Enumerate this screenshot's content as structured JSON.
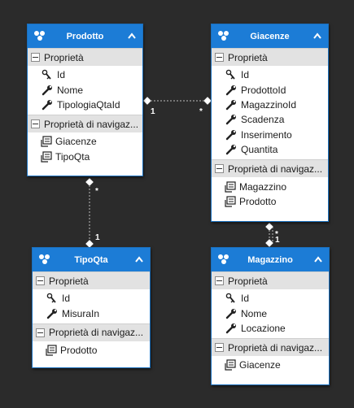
{
  "colors": {
    "background": "#2b2b2b",
    "entity_header": "#1c7cd6",
    "section_header": "#e2e2e2",
    "connector": "#bdbdbd"
  },
  "entities": {
    "prodotto": {
      "title": "Prodotto",
      "properties_label": "Proprietà",
      "properties": [
        "Id",
        "Nome",
        "TipologiaQtaId"
      ],
      "property_icons": [
        "key-wrench-icon",
        "wrench-icon",
        "wrench-icon"
      ],
      "nav_label": "Proprietà di navigaz...",
      "nav_properties": [
        "Giacenze",
        "TipoQta"
      ]
    },
    "giacenze": {
      "title": "Giacenze",
      "properties_label": "Proprietà",
      "properties": [
        "Id",
        "ProdottoId",
        "MagazzinoId",
        "Scadenza",
        "Inserimento",
        "Quantita"
      ],
      "property_icons": [
        "key-wrench-icon",
        "wrench-icon",
        "wrench-icon",
        "wrench-icon",
        "wrench-icon",
        "wrench-icon"
      ],
      "nav_label": "Proprietà di navigaz...",
      "nav_properties": [
        "Magazzino",
        "Prodotto"
      ]
    },
    "tipoqta": {
      "title": "TipoQta",
      "properties_label": "Proprietà",
      "properties": [
        "Id",
        "MisuraIn"
      ],
      "property_icons": [
        "key-wrench-icon",
        "wrench-icon"
      ],
      "nav_label": "Proprietà di navigaz...",
      "nav_properties": [
        "Prodotto"
      ]
    },
    "magazzino": {
      "title": "Magazzino",
      "properties_label": "Proprietà",
      "properties": [
        "Id",
        "Nome",
        "Locazione"
      ],
      "property_icons": [
        "key-wrench-icon",
        "wrench-icon",
        "wrench-icon"
      ],
      "nav_label": "Proprietà di navigaz...",
      "nav_properties": [
        "Giacenze"
      ]
    }
  },
  "associations": [
    {
      "from": "Prodotto",
      "to": "Giacenze",
      "from_multiplicity": "1",
      "to_multiplicity": "*"
    },
    {
      "from": "Prodotto",
      "to": "TipoQta",
      "from_multiplicity": "*",
      "to_multiplicity": "1"
    },
    {
      "from": "Giacenze",
      "to": "Magazzino",
      "from_multiplicity": "*",
      "to_multiplicity": "1"
    }
  ]
}
